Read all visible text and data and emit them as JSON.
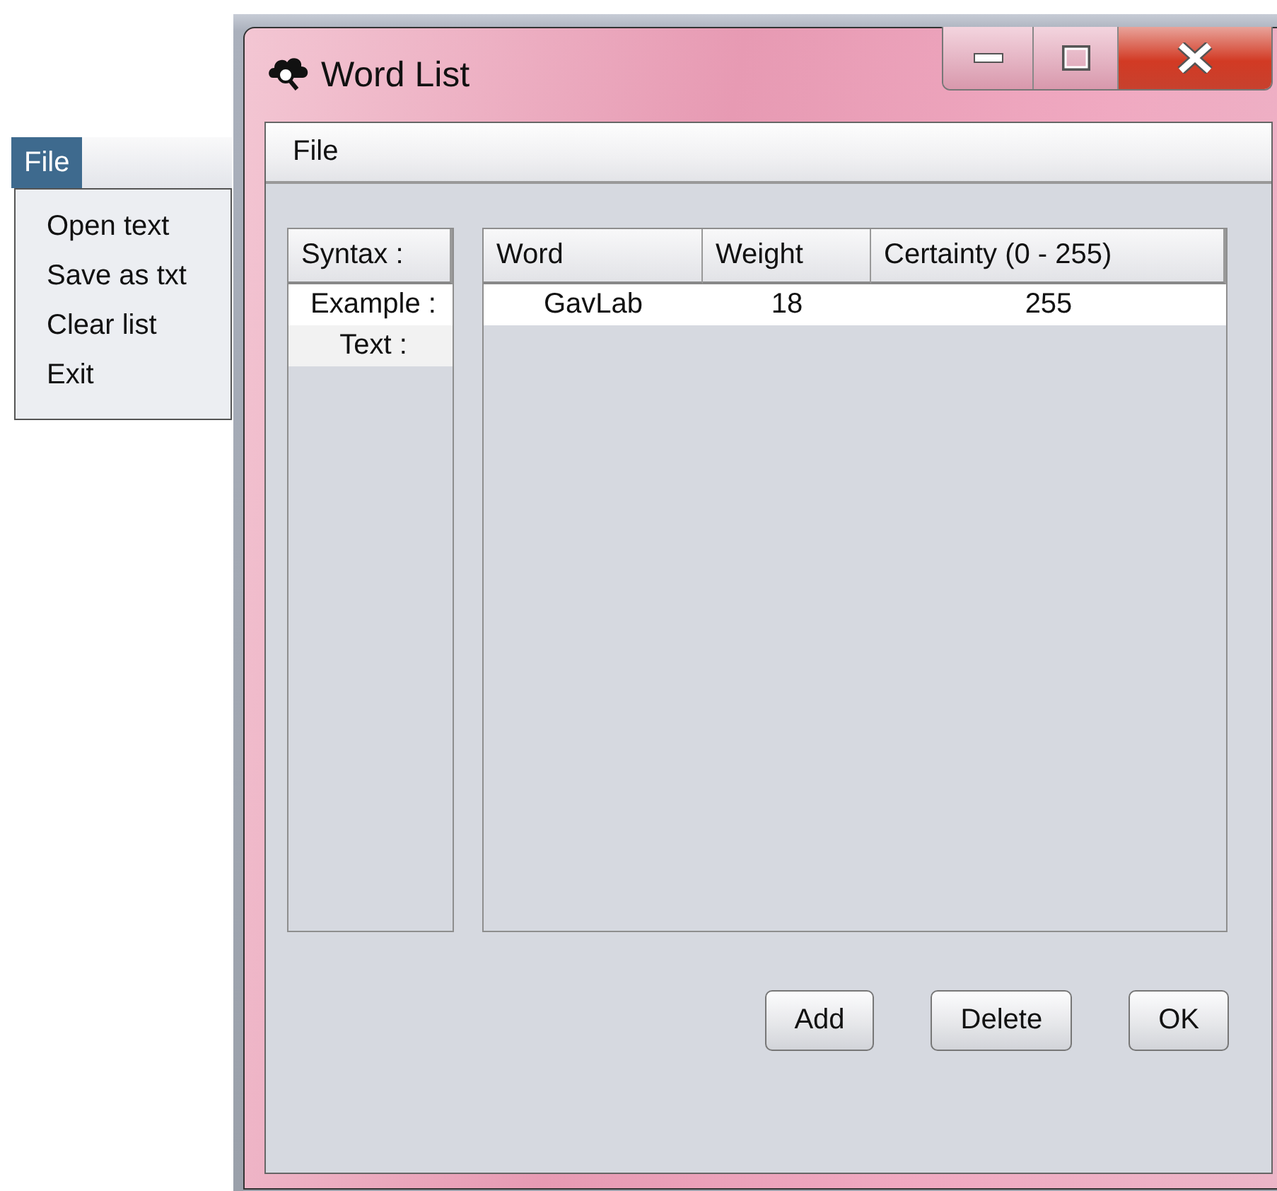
{
  "popup_menu": {
    "title": "File",
    "items": [
      "Open text",
      "Save as txt",
      "Clear list",
      "Exit"
    ]
  },
  "window": {
    "title": "Word List"
  },
  "menu_bar": [
    "File"
  ],
  "syntax_list": {
    "header": "Syntax :",
    "items": [
      "Example :",
      "Text :"
    ]
  },
  "table": {
    "columns": [
      "Word",
      "Weight",
      "Certainty (0 - 255)"
    ],
    "rows": [
      [
        "GavLab",
        "18",
        "255"
      ]
    ]
  },
  "buttons": [
    "Add",
    "Delete",
    "OK"
  ]
}
